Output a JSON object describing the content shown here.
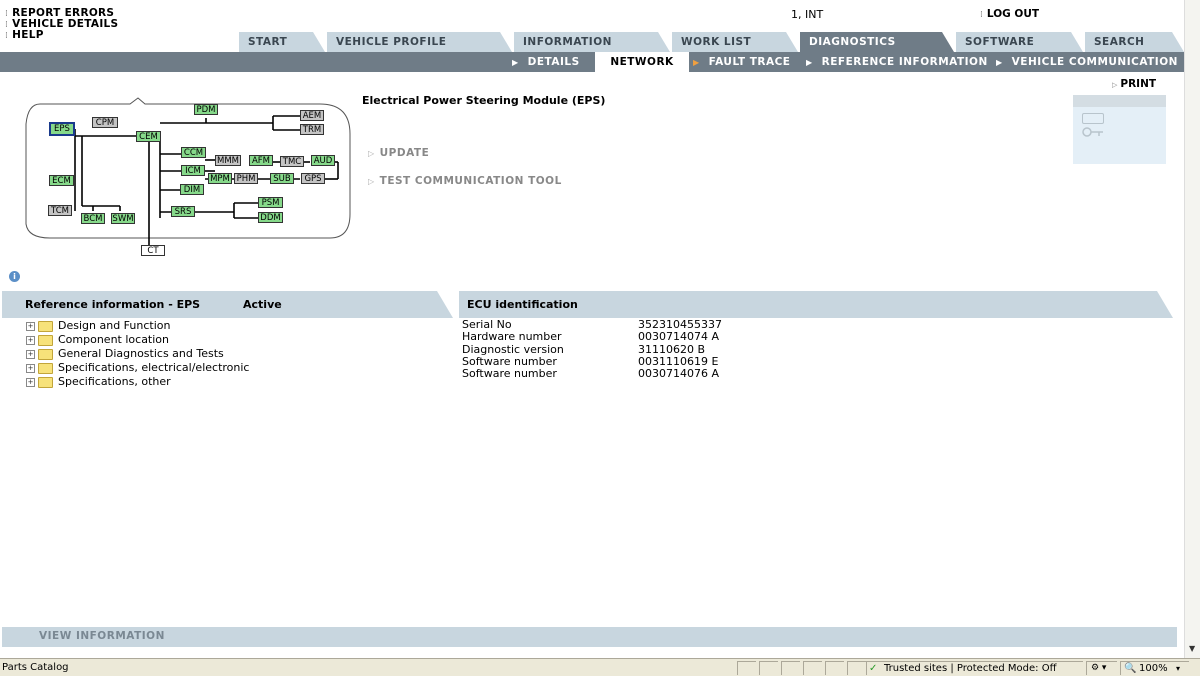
{
  "top_links": [
    "REPORT ERRORS",
    "VEHICLE DETAILS",
    "HELP"
  ],
  "user": "1, INT",
  "logout": "LOG OUT",
  "tabs": [
    "START",
    "VEHICLE PROFILE",
    "INFORMATION",
    "WORK LIST",
    "DIAGNOSTICS",
    "SOFTWARE",
    "SEARCH"
  ],
  "active_tab": "DIAGNOSTICS",
  "subtabs": [
    "DETAILS",
    "NETWORK",
    "FAULT TRACE",
    "REFERENCE INFORMATION",
    "VEHICLE COMMUNICATION"
  ],
  "active_subtab": "NETWORK",
  "print": "PRINT",
  "module_title": "Electrical Power Steering Module (EPS)",
  "actions": [
    "UPDATE",
    "TEST COMMUNICATION TOOL"
  ],
  "network_nodes": [
    "EPS",
    "CPM",
    "PDM",
    "AEM",
    "TRM",
    "CEM",
    "CCM",
    "MMM",
    "AFM",
    "TMC",
    "AUD",
    "ECM",
    "ICM",
    "MPM",
    "PHM",
    "SUB",
    "GPS",
    "DIM",
    "TCM",
    "BCM",
    "SWM",
    "SRS",
    "PSM",
    "DDM",
    "CT"
  ],
  "reference_panel": {
    "title": "Reference information - EPS",
    "status": "Active",
    "tree": [
      "Design and Function",
      "Component location",
      "General Diagnostics and Tests",
      "Specifications, electrical/electronic",
      "Specifications, other"
    ]
  },
  "ecu_panel": {
    "title": "ECU identification",
    "rows": [
      {
        "label": "Serial No",
        "value": "352310455337"
      },
      {
        "label": "Hardware number",
        "value": "0030714074  A"
      },
      {
        "label": "Diagnostic version",
        "value": "31110620  B"
      },
      {
        "label": "Software number",
        "value": "0031110619  E"
      },
      {
        "label": "Software number",
        "value": "0030714076  A"
      }
    ]
  },
  "view_information": "VIEW INFORMATION",
  "status": {
    "left": "Parts Catalog",
    "zone": "Trusted sites | Protected Mode: Off",
    "zoom": "100%"
  }
}
